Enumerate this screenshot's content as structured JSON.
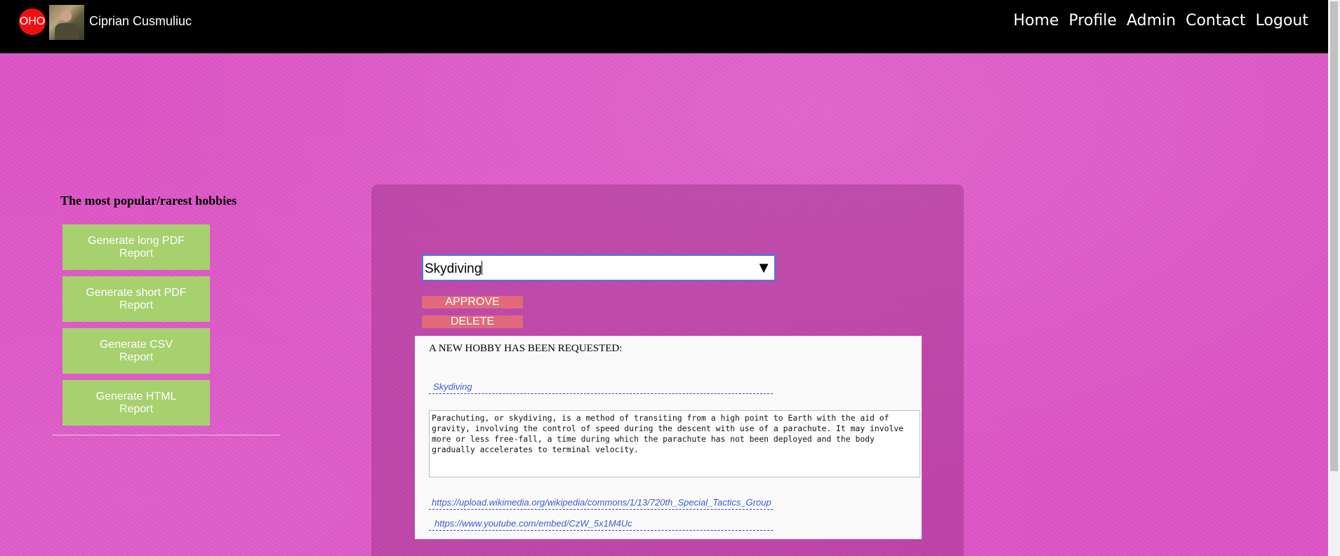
{
  "header": {
    "logo_text": "OHO",
    "user_name": "Ciprian Cusmuliuc",
    "nav": [
      "Home",
      "Profile",
      "Admin",
      "Contact",
      "Logout"
    ]
  },
  "sidebar": {
    "title": "The most popular/rarest hobbies",
    "buttons": [
      "Generate long PDF Report",
      "Generate short PDF Report",
      "Generate CSV Report",
      "Generate HTML Report"
    ]
  },
  "main": {
    "select": {
      "value": "Skydiving",
      "arrow": "▼"
    },
    "approve_label": "APPROVE",
    "delete_label": "DELETE",
    "request": {
      "title": "A NEW HOBBY HAS BEEN REQUESTED:",
      "name": "Skydiving",
      "description": "Parachuting, or skydiving, is a method of transiting from a high point to Earth with the aid of gravity, involving the control of speed during the descent with use of a parachute. It may involve more or less free-fall, a time during which the parachute has not been deployed and the body gradually accelerates to terminal velocity.",
      "image_link": "https://upload.wikimedia.org/wikipedia/commons/1/13/720th_Special_Tactics_Group",
      "video_link": "https://www.youtube.com/embed/CzW_5x1M4Uc"
    }
  },
  "colors": {
    "background": "#dd55c6",
    "topbar": "#000000",
    "report_button": "#a6d16e",
    "action_button": "#e06a7a",
    "link": "#3b5bd6"
  }
}
